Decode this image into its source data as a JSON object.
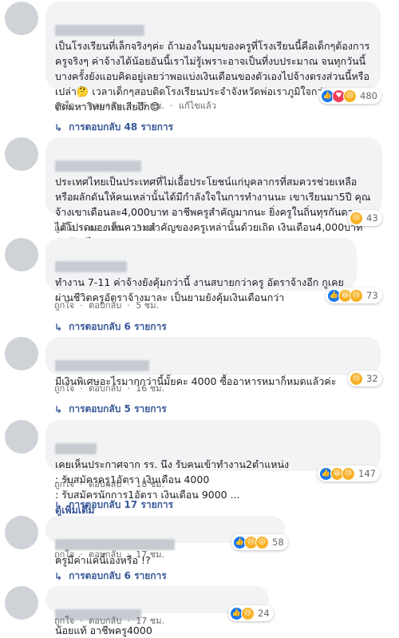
{
  "actions": {
    "like": "ถูกใจ",
    "reply": "ตอบกลับ",
    "edited": "แก้ไขแล้ว"
  },
  "colors": {
    "bubble": "#f2f3f5",
    "link": "#385898",
    "like": "#1877f2",
    "love": "#f33e58",
    "emoji": "#f7b125"
  },
  "comments": [
    {
      "text": "เป็นโรงเรียนที่เล็กจริงๆค่ะ ถ้ามองในมุมของครูที่โรงเรียนนี้คือเด็กๆต้องการครูจริงๆ ค่าจ้างได้น้อยอันนี้เราไม่รู้เพราะอาจเป็นที่งบประมาณ จนทุกวันนี้บางครั้งยังแอบคิดอยู่เลยว่าพอแบ่งเงินเดือนของตัวเองไปจ้างตรงส่วนนี้หรือเปล่า🤔 เวลาเด็กๆสอบติดโรงเรียนประจำจังหวัดพ่อเราภูมิใจกว่าลูกสอบติดมหาวิทยาลัยเสียอีก😊",
      "time": "16 ชม.",
      "reaction_count": "480",
      "reaction_icons": [
        "like-icon",
        "love-icon",
        "sad-icon"
      ],
      "replies": "การตอบกลับ 48 รายการ"
    },
    {
      "text": "ประเทศไทยเป็นประเทศที่ไม่เอื้อประโยชน์แก่บุคลากรที่สมควรช่วยเหลือ หรือผลักดันให้คนเหล่านั้นได้มีกำลังใจในการทำงานนะ เขาเรียนมา5ปี คุณจ้างเขาเดือนละ4,000บาท อาชีพครูสำคัญมากนะ ยิ่งครูในถิ่นทุรกันดาร ได้โปรดมองเห็นความสำคัญของครูเหล่านั้นด้วยเถิด เงินเดือน4,000บาทมันน้อยไปจริงๆ",
      "time": "3 ชม.",
      "reaction_count": "43",
      "reaction_icons": [
        "sad-icon"
      ]
    },
    {
      "text": "ทำงาน 7-11 ค่าจ้างยังคุ้มกว่านี้ งานสบายกว่าครู อัตราจ้างอีก กูเคยผ่านชีวิตครูอัตราจ้างมาละ เป็นยามยังคุ้มเงินเดือนกว่า",
      "time": "5 ชม.",
      "reaction_count": "73",
      "reaction_icons": [
        "like-icon",
        "haha-icon",
        "sad-icon"
      ],
      "replies": "การตอบกลับ 6 รายการ"
    },
    {
      "text": "มีเงินพิเศษอะไรมากกว่านี้มั้ยคะ 4000 ซื้ออาหารหมาก็หมดแล้วค่ะ",
      "time": "16 ชม.",
      "reaction_count": "32",
      "reaction_icons": [
        "sad-icon"
      ],
      "replies": "การตอบกลับ 5 รายการ"
    },
    {
      "text": "เคยเห็นประกาศจาก รร. นึง รับคนเข้าทำงาน2ตำแหน่ง\n: รับสมัครครู1อัตรา เงินเดือน 4000\n: รับสมัครนักการ1อัตรา เงินเดือน 9000 ...",
      "more": "ดูเพิ่มเติม",
      "time": "18 ชม.",
      "reaction_count": "147",
      "reaction_icons": [
        "like-icon",
        "haha-icon",
        "sad-icon"
      ],
      "replies": "การตอบกลับ 17 รายการ"
    },
    {
      "text": "ครูมีค่าแค่นี้เองหรือ !?",
      "time": "17 ชม.",
      "reaction_count": "58",
      "reaction_icons": [
        "like-icon",
        "sad-icon",
        "wow-icon"
      ],
      "replies": "การตอบกลับ 6 รายการ"
    },
    {
      "text": "น้อยแท้ อาชีพครู4000",
      "time": "17 ชม.",
      "reaction_count": "24",
      "reaction_icons": [
        "like-icon",
        "sad-icon"
      ]
    }
  ]
}
